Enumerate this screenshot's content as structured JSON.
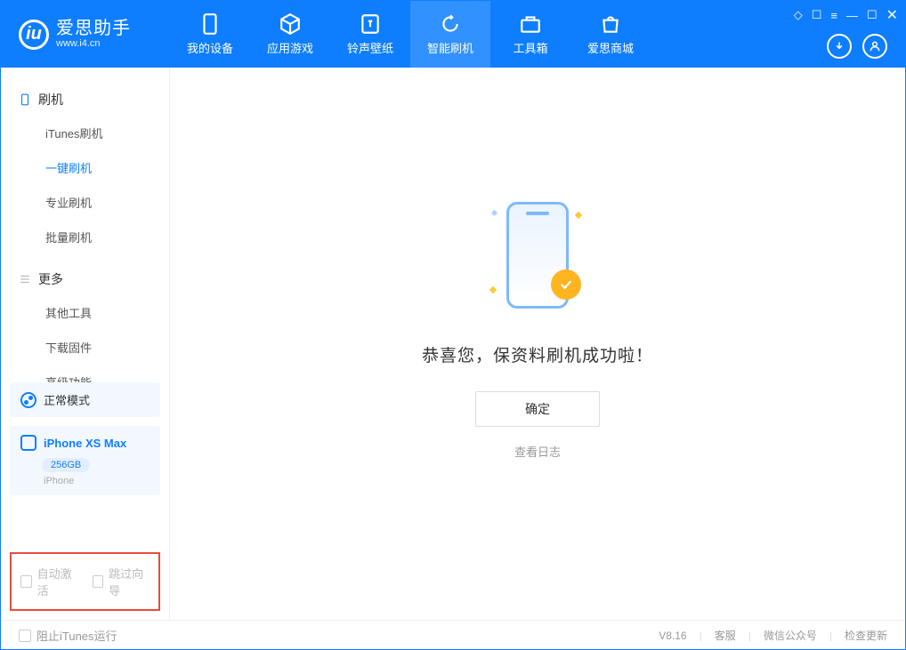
{
  "app": {
    "title": "爱思助手",
    "subtitle": "www.i4.cn",
    "logo_letter": "iu"
  },
  "tabs": {
    "device": "我的设备",
    "apps": "应用游戏",
    "ringtone": "铃声壁纸",
    "flash": "智能刷机",
    "toolbox": "工具箱",
    "store": "爱思商城"
  },
  "sidebar": {
    "section1": "刷机",
    "items1": [
      "iTunes刷机",
      "一键刷机",
      "专业刷机",
      "批量刷机"
    ],
    "section2": "更多",
    "items2": [
      "其他工具",
      "下载固件",
      "高级功能"
    ]
  },
  "device": {
    "mode": "正常模式",
    "name": "iPhone XS Max",
    "badge": "256GB",
    "sub": "iPhone"
  },
  "options": {
    "auto_activate": "自动激活",
    "skip_guide": "跳过向导"
  },
  "main": {
    "success": "恭喜您，保资料刷机成功啦！",
    "ok": "确定",
    "log": "查看日志"
  },
  "footer": {
    "block_itunes": "阻止iTunes运行",
    "version": "V8.16",
    "support": "客服",
    "wechat": "微信公众号",
    "update": "检查更新"
  }
}
